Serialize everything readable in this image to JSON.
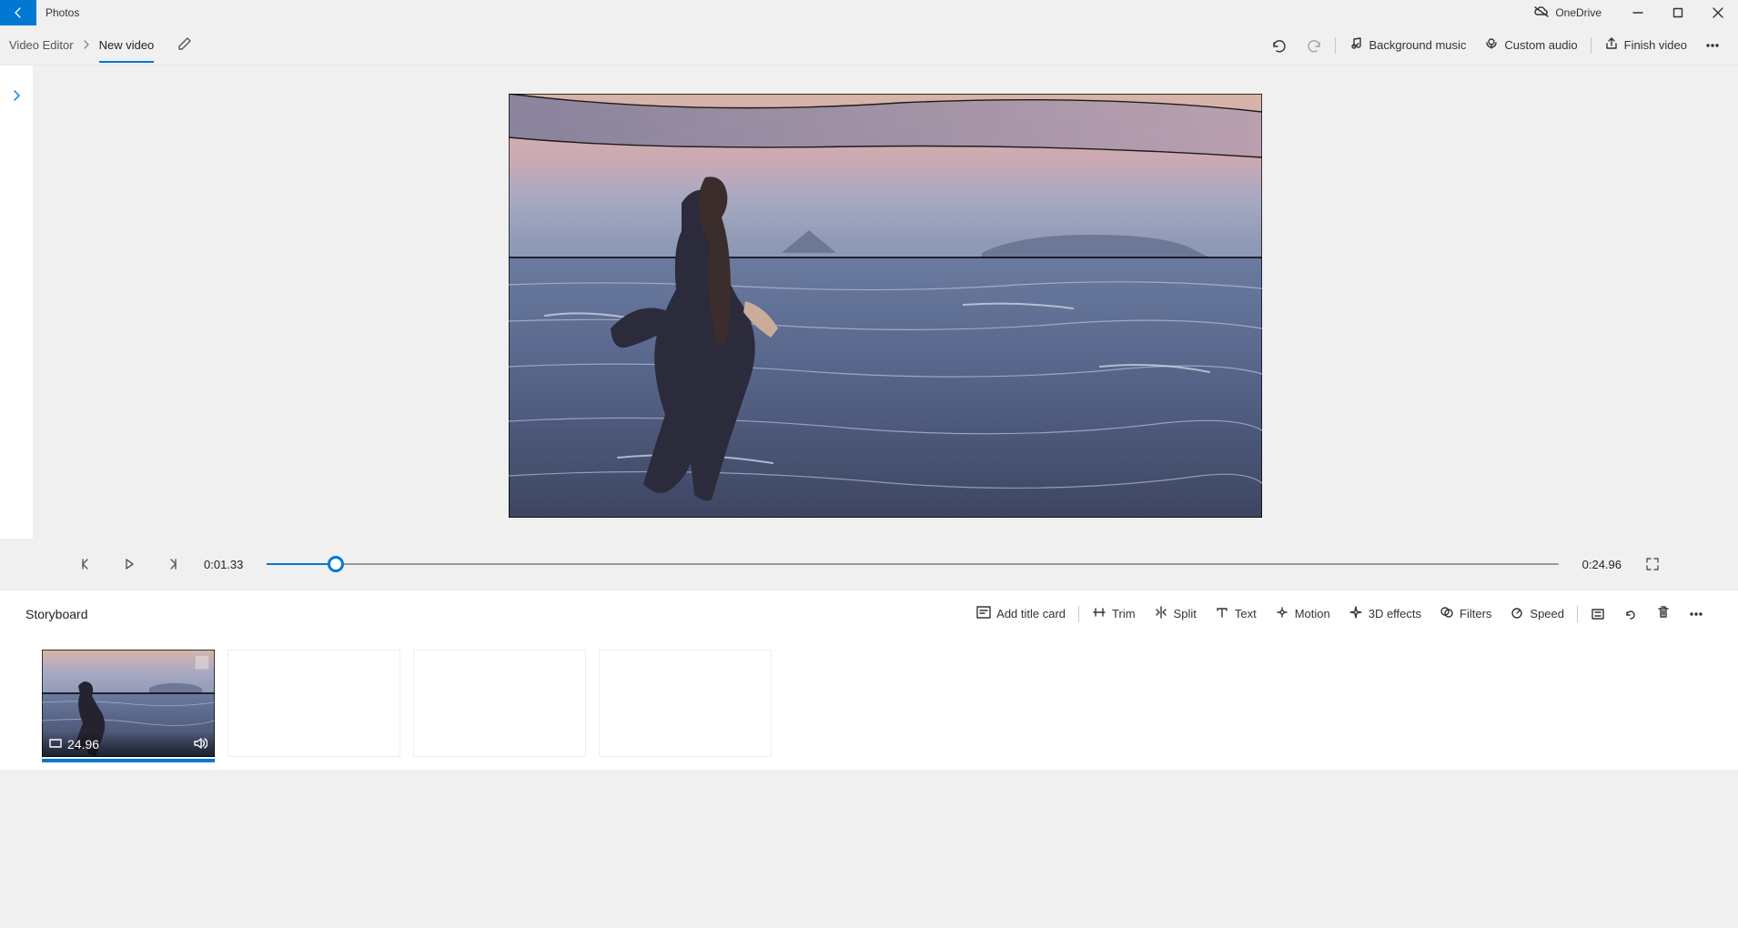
{
  "titlebar": {
    "app_name": "Photos",
    "onedrive_label": "OneDrive"
  },
  "breadcrumb": {
    "crumb1": "Video Editor",
    "crumb2": "New video"
  },
  "commands": {
    "bg_music": "Background music",
    "custom_audio": "Custom audio",
    "finish_video": "Finish video"
  },
  "player": {
    "current_time": "0:01.33",
    "total_time": "0:24.96"
  },
  "storyboard": {
    "title": "Storyboard",
    "add_title_card": "Add title card",
    "trim": "Trim",
    "split": "Split",
    "text": "Text",
    "motion": "Motion",
    "effects3d": "3D effects",
    "filters": "Filters",
    "speed": "Speed",
    "clips": [
      {
        "duration": "24.96",
        "selected": true,
        "has_media": true
      }
    ]
  }
}
